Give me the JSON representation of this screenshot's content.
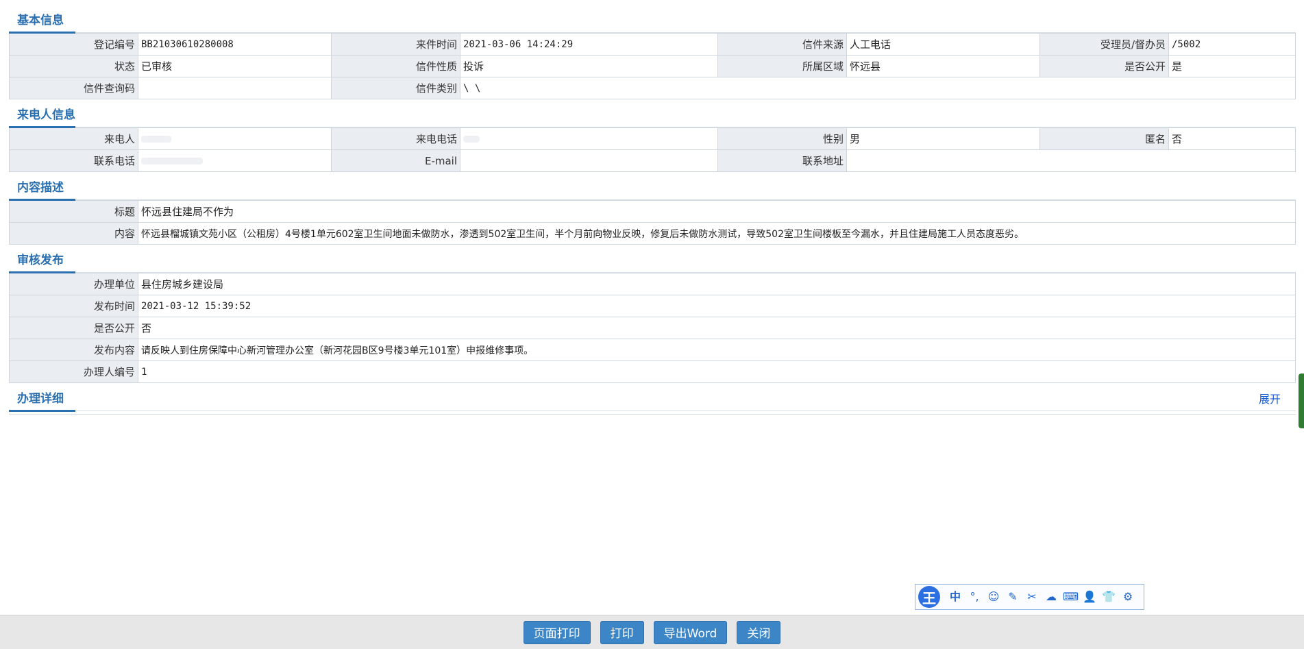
{
  "sections": {
    "basic": "基本信息",
    "caller": "来电人信息",
    "content": "内容描述",
    "review": "审核发布",
    "detail": "办理详细"
  },
  "basic": {
    "reg_no_label": "登记编号",
    "reg_no": "BB21030610280008",
    "time_label": "来件时间",
    "time": "2021-03-06 14:24:29",
    "source_label": "信件来源",
    "source": "人工电话",
    "handler_label": "受理员/督办员",
    "handler": "/5002",
    "status_label": "状态",
    "status": "已审核",
    "nature_label": "信件性质",
    "nature": "投诉",
    "region_label": "所属区域",
    "region": "怀远县",
    "public_label": "是否公开",
    "public": "是",
    "query_label": "信件查询码",
    "query": "",
    "category_label": "信件类别",
    "category": "\\ \\"
  },
  "caller": {
    "name_label": "来电人",
    "phone_label": "来电电话",
    "gender_label": "性别",
    "gender": "男",
    "anon_label": "匿名",
    "anon": "否",
    "contact_label": "联系电话",
    "email_label": "E-mail",
    "email": "",
    "address_label": "联系地址",
    "address": ""
  },
  "content": {
    "title_label": "标题",
    "title": "怀远县住建局不作为",
    "body_label": "内容",
    "body": "怀远县榴城镇文苑小区（公租房）4号楼1单元602室卫生间地面未做防水，渗透到502室卫生间，半个月前向物业反映，修复后未做防水测试，导致502室卫生间楼板至今漏水，并且住建局施工人员态度恶劣。"
  },
  "review": {
    "unit_label": "办理单位",
    "unit": "县住房城乡建设局",
    "pub_time_label": "发布时间",
    "pub_time": "2021-03-12 15:39:52",
    "public_label": "是否公开",
    "public": "否",
    "pub_content_label": "发布内容",
    "pub_content": "请反映人到住房保障中心新河管理办公室（新河花园B区9号楼3单元101室）申报维修事项。",
    "handler_no_label": "办理人编号",
    "handler_no": "1"
  },
  "detail": {
    "expand": "展开"
  },
  "ime": {
    "logo": "王",
    "lang": "中"
  },
  "footer": {
    "page_print": "页面打印",
    "print": "打印",
    "export_word": "导出Word",
    "close": "关闭"
  }
}
